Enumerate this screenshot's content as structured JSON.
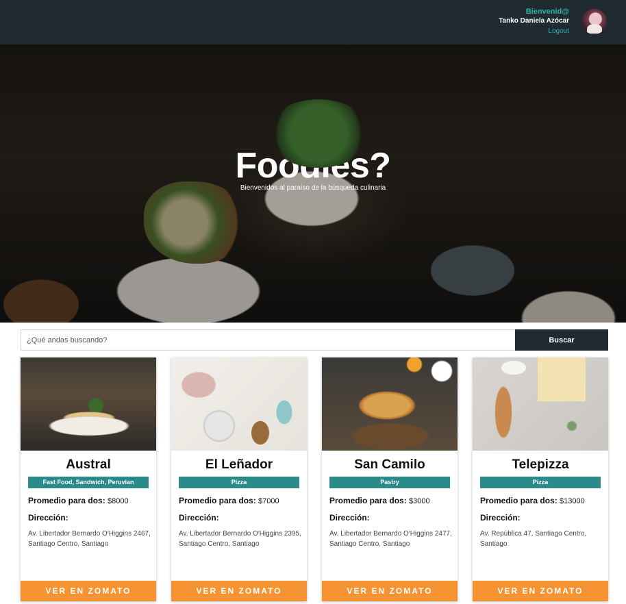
{
  "header": {
    "greeting": "Bienvenid@",
    "user_name": "Tanko Daniela Azócar",
    "logout_label": "Logout"
  },
  "hero": {
    "title": "Foodies?",
    "subtitle": "Bienvenidos al paraíso de la búsqueda culinaria"
  },
  "search": {
    "placeholder": "¿Qué andas buscando?",
    "button_label": "Buscar"
  },
  "labels": {
    "price_prefix": "Promedio para dos:",
    "address": "Dirección:",
    "cta": "VER EN ZOMATO"
  },
  "restaurants": [
    {
      "name": "Austral",
      "cuisines": "Fast Food, Sandwich, Peruvian",
      "price": "$8000",
      "address": "Av. Libertador Bernardo O'Higgins 2467, Santiago Centro, Santiago"
    },
    {
      "name": "El Leñador",
      "cuisines": "Pizza",
      "price": "$7000",
      "address": "Av. Libertador Bernardo O'Higgins 2395, Santiago Centro, Santiago"
    },
    {
      "name": "San Camilo",
      "cuisines": "Pastry",
      "price": "$3000",
      "address": "Av. Libertador Bernardo O'Higgins 2477, Santiago Centro, Santiago"
    },
    {
      "name": "Telepizza",
      "cuisines": "Pizza",
      "price": "$13000",
      "address": "Av. República 47, Santiago Centro, Santiago"
    }
  ],
  "colors": {
    "topbar": "#1f2b31",
    "accent_teal": "#2bb3b0",
    "category_badge": "#2b8a8a",
    "cta_orange": "#f59332"
  }
}
